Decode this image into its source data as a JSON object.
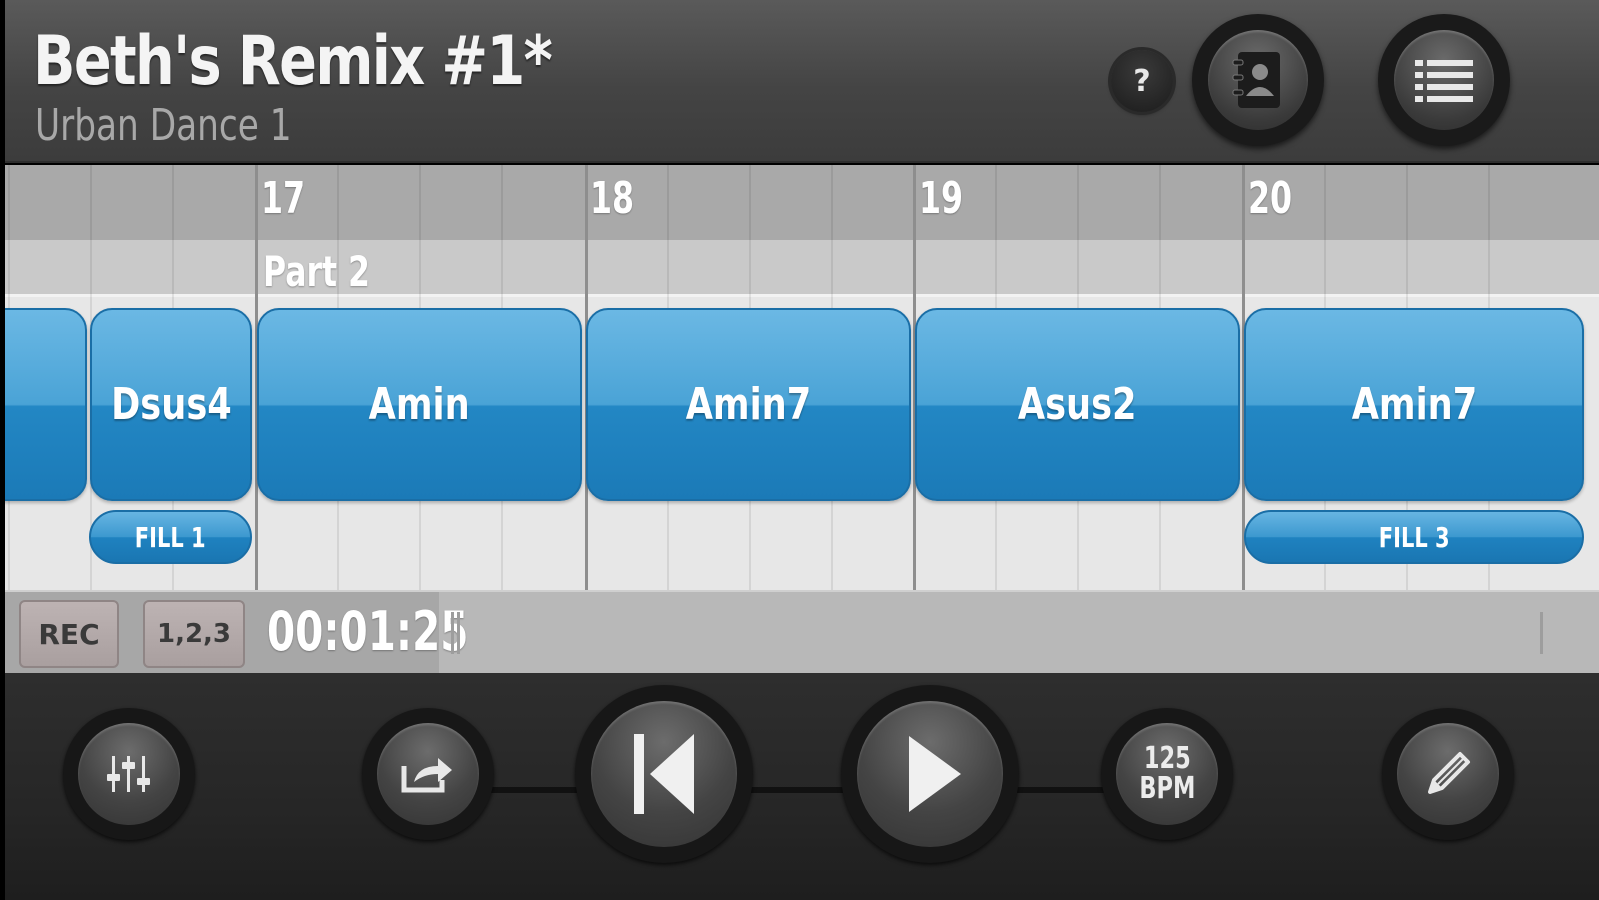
{
  "header": {
    "title": "Beth's Remix #1*",
    "subtitle": "Urban Dance 1",
    "help_label": "?",
    "icons": [
      "contacts-book-icon",
      "list-menu-icon"
    ]
  },
  "timeline": {
    "bars": [
      "17",
      "18",
      "19",
      "20"
    ],
    "part_label": "Part 2",
    "chords": [
      "",
      "Dsus4",
      "Amin",
      "Amin7",
      "Asus2",
      "Amin7"
    ],
    "fills": [
      "FILL 1",
      "FILL 3"
    ]
  },
  "status": {
    "rec_label": "REC",
    "count_in_label": "1,2,3",
    "time": "00:01:25"
  },
  "controls": {
    "bpm_value": "125",
    "bpm_unit": "BPM",
    "icons": [
      "mixer-sliders-icon",
      "share-icon",
      "skip-back-icon",
      "play-icon",
      "pencil-icon"
    ]
  },
  "colors": {
    "chord_blue": "#2387c4",
    "header_gray": "#4a4a4a",
    "control_dark": "#262626"
  }
}
